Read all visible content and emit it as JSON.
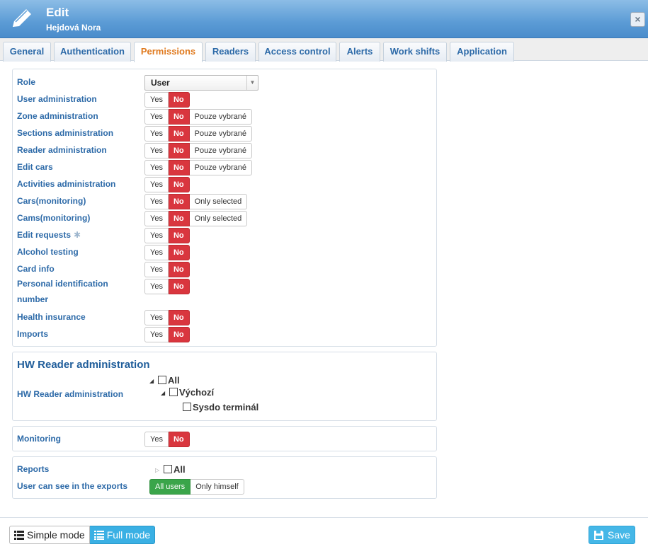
{
  "header": {
    "title": "Edit",
    "subtitle": "Hejdová Nora",
    "close_label": "×"
  },
  "tabs": [
    "General",
    "Authentication",
    "Permissions",
    "Readers",
    "Access control",
    "Alerts",
    "Work shifts",
    "Application"
  ],
  "active_tab": "Permissions",
  "role": {
    "label": "Role",
    "value": "User"
  },
  "permissions": [
    {
      "label": "User administration",
      "yes": "Yes",
      "no": "No"
    },
    {
      "label": "Zone administration",
      "yes": "Yes",
      "no": "No",
      "extra": "Pouze vybrané"
    },
    {
      "label": "Sections administration",
      "yes": "Yes",
      "no": "No",
      "extra": "Pouze vybrané"
    },
    {
      "label": "Reader administration",
      "yes": "Yes",
      "no": "No",
      "extra": "Pouze vybrané"
    },
    {
      "label": "Edit cars",
      "yes": "Yes",
      "no": "No",
      "extra": "Pouze vybrané"
    },
    {
      "label": "Activities administration",
      "yes": "Yes",
      "no": "No"
    },
    {
      "label": "Cars(monitoring)",
      "yes": "Yes",
      "no": "No",
      "extra": "Only selected"
    },
    {
      "label": "Cams(monitoring)",
      "yes": "Yes",
      "no": "No",
      "extra": "Only selected"
    },
    {
      "label": "Edit requests",
      "yes": "Yes",
      "no": "No",
      "icon": "gear-icon"
    },
    {
      "label": "Alcohol testing",
      "yes": "Yes",
      "no": "No"
    },
    {
      "label": "Card info",
      "yes": "Yes",
      "no": "No"
    },
    {
      "label": "Personal identification number",
      "yes": "Yes",
      "no": "No"
    },
    {
      "label": "Health insurance",
      "yes": "Yes",
      "no": "No"
    },
    {
      "label": "Imports",
      "yes": "Yes",
      "no": "No"
    }
  ],
  "hw_reader": {
    "title": "HW Reader administration",
    "label": "HW Reader administration",
    "tree": {
      "all": "All",
      "group": "Výchozí",
      "item": "Sysdo terminál"
    }
  },
  "monitoring": {
    "label": "Monitoring",
    "yes": "Yes",
    "no": "No"
  },
  "reports": {
    "label": "Reports",
    "all": "All",
    "exports_label": "User can see in the exports",
    "all_users": "All users",
    "only_himself": "Only himself"
  },
  "footer": {
    "simple_mode": "Simple mode",
    "full_mode": "Full mode",
    "save": "Save"
  },
  "colors": {
    "accent": "#2d6aa8",
    "no_red": "#d9363e",
    "active_tab": "#e07a1f",
    "green": "#3aa54a",
    "save_blue": "#45b7e7"
  }
}
